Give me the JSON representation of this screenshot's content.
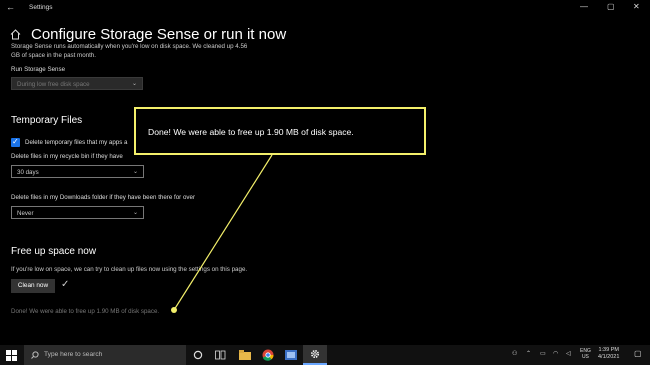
{
  "window": {
    "title": "Settings",
    "back_icon": "←",
    "minimize": "—",
    "maximize": "▢",
    "close": "✕"
  },
  "header": {
    "title": "Configure Storage Sense or run it now",
    "description": "Storage Sense runs automatically when you're low on disk space. We cleaned up 4.56 GB of space in the past month."
  },
  "run_storage_sense": {
    "label": "Run Storage Sense",
    "value": "During low free disk space"
  },
  "temporary_files": {
    "heading": "Temporary Files",
    "checkbox_label": "Delete temporary files that my apps a",
    "recycle_label": "Delete files in my recycle bin if they have",
    "recycle_value": "30 days",
    "downloads_label": "Delete files in my Downloads folder if they have been there for over",
    "downloads_value": "Never"
  },
  "free_up": {
    "heading": "Free up space now",
    "description": "If you're low on space, we can try to clean up files now using the settings on this page.",
    "button": "Clean now",
    "status": "Done! We were able to free up 1.90 MB of disk space."
  },
  "callout": {
    "text": "Done! We were able to free up 1.90 MB of disk space."
  },
  "taskbar": {
    "search_placeholder": "Type here to search",
    "lang": "ENG",
    "region": "US",
    "time": "1:39 PM",
    "date": "4/1/2021"
  },
  "colors": {
    "accent": "#1a73e8",
    "callout_border": "#f3ef6a"
  }
}
